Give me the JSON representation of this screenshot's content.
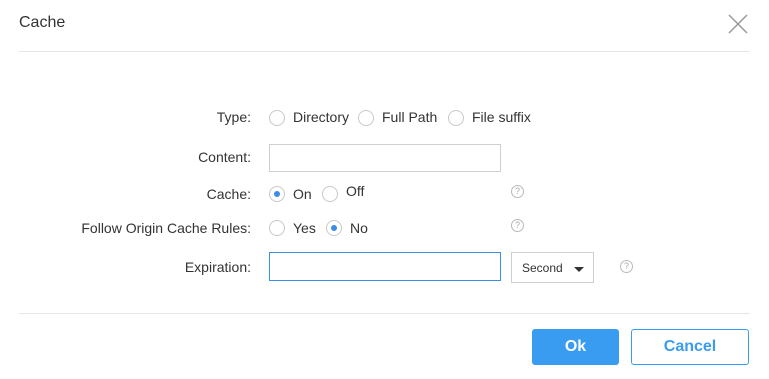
{
  "dialog": {
    "title": "Cache",
    "close_icon": "close-icon"
  },
  "form": {
    "type": {
      "label": "Type:",
      "options": [
        "Directory",
        "Full Path",
        "File suffix"
      ],
      "selected": null
    },
    "content": {
      "label": "Content:",
      "value": "",
      "placeholder": ""
    },
    "cache": {
      "label": "Cache:",
      "options": [
        "On",
        "Off"
      ],
      "selected": "On",
      "help_icon": "question-icon"
    },
    "follow_origin": {
      "label": "Follow Origin Cache Rules:",
      "options": [
        "Yes",
        "No"
      ],
      "selected": "No",
      "help_icon": "question-icon"
    },
    "expiration": {
      "label": "Expiration:",
      "value": "",
      "placeholder": "",
      "unit_selected": "Second",
      "help_icon": "question-icon"
    },
    "help_glyph": "?"
  },
  "footer": {
    "ok_label": "Ok",
    "cancel_label": "Cancel"
  },
  "colors": {
    "accent": "#3a9cf0",
    "radio_dot": "#3a8ee6",
    "divider": "#e6e6e6"
  }
}
